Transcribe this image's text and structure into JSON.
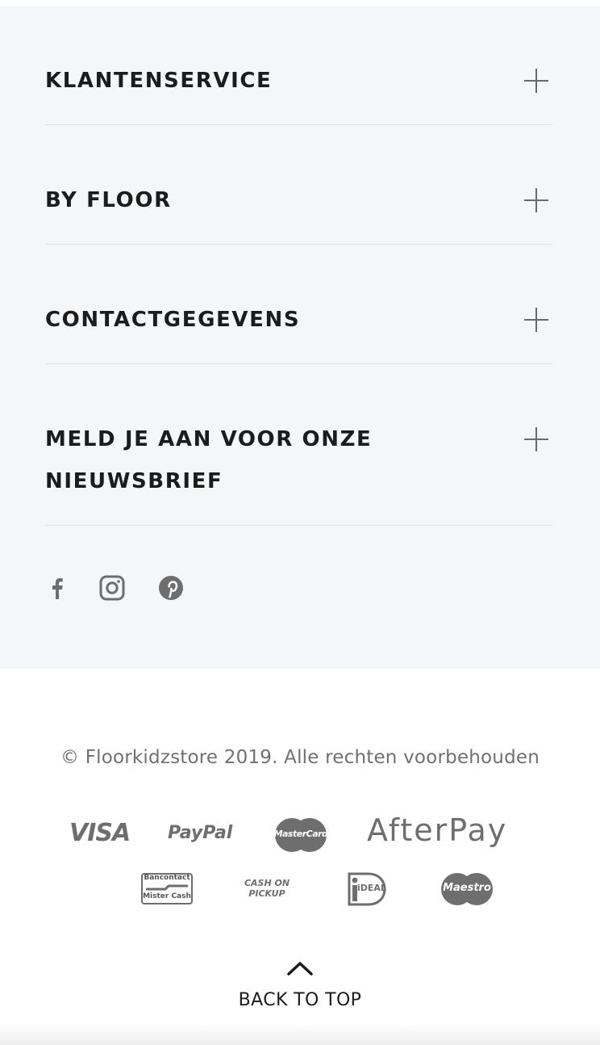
{
  "footer": {
    "accordion": [
      {
        "label": "KLANTENSERVICE"
      },
      {
        "label": "BY FLOOR"
      },
      {
        "label": "CONTACTGEGEVENS"
      },
      {
        "label": "MELD JE AAN VOOR ONZE NIEUWSBRIEF",
        "lines": [
          "MELD JE AAN VOOR ONZE",
          "NIEUWSBRIEF"
        ]
      }
    ],
    "social": [
      "facebook-icon",
      "instagram-icon",
      "pinterest-icon"
    ]
  },
  "bottom": {
    "copyright": "© Floorkidzstore 2019. Alle rechten voorbehouden",
    "payments": {
      "visa": "VISA",
      "paypal": "PayPal",
      "mastercard": "MasterCard",
      "afterpay": "AfterPay",
      "bancontact_top": "Bancontact",
      "bancontact_bottom": "Mister Cash",
      "cash_top": "CASH ON",
      "cash_bottom": "PICKUP",
      "ideal": "iDEAL",
      "maestro": "Maestro"
    },
    "back_to_top": "BACK TO TOP"
  },
  "colors": {
    "panel_bg": "#f5f6f8",
    "text_dark": "#1c1c1c",
    "icon_gray": "#6e6e6e",
    "divider": "#e1e2e5"
  }
}
